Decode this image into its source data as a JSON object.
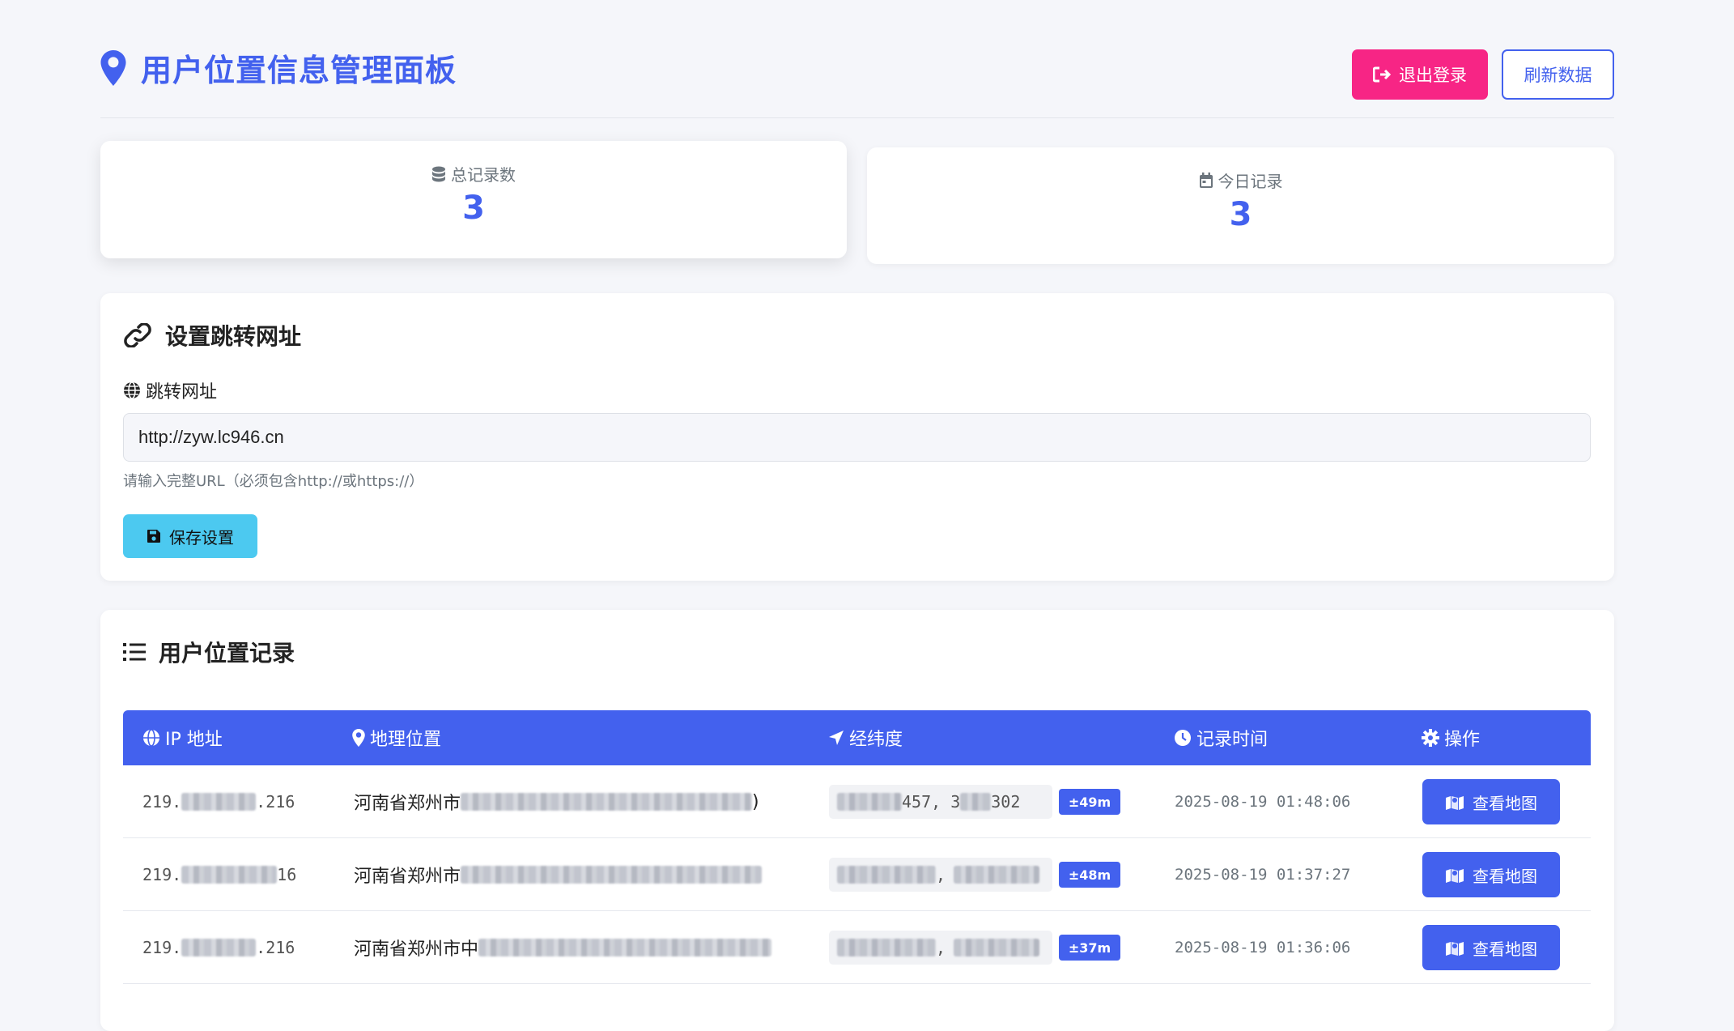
{
  "header": {
    "title": "用户位置信息管理面板",
    "logout_label": "退出登录",
    "refresh_label": "刷新数据"
  },
  "stats": [
    {
      "label": "总记录数",
      "value": "3",
      "icon": "database-icon"
    },
    {
      "label": "今日记录",
      "value": "3",
      "icon": "calendar-icon"
    }
  ],
  "settings": {
    "title": "设置跳转网址",
    "field_label": "跳转网址",
    "url_value": "http://zyw.lc946.cn",
    "hint": "请输入完整URL（必须包含http://或https://）",
    "save_label": "保存设置"
  },
  "records": {
    "title": "用户位置记录",
    "columns": [
      "IP 地址",
      "地理位置",
      "经纬度",
      "记录时间",
      "操作"
    ],
    "rows": [
      {
        "ip_start": "219.",
        "ip_end": ".216",
        "location": "河南省郑州市",
        "loc_tail": ")",
        "coord_mid": "457, 3",
        "coord_end": "302",
        "accuracy": "±49m",
        "time": "2025-08-19 01:48:06",
        "action": "查看地图"
      },
      {
        "ip_start": "219.",
        "ip_end": "16",
        "location": "河南省郑州市",
        "loc_tail": "",
        "coord_mid": ",",
        "coord_end": "",
        "accuracy": "±48m",
        "time": "2025-08-19 01:37:27",
        "action": "查看地图"
      },
      {
        "ip_start": "219.",
        "ip_end": ".216",
        "location": "河南省郑州市中",
        "loc_tail": "",
        "coord_mid": ",",
        "coord_end": "",
        "accuracy": "±37m",
        "time": "2025-08-19 01:36:06",
        "action": "查看地图"
      }
    ]
  },
  "colors": {
    "primary": "#4361ee",
    "logout": "#f72585",
    "save": "#4cc9f0",
    "background": "#f5f6fa"
  }
}
